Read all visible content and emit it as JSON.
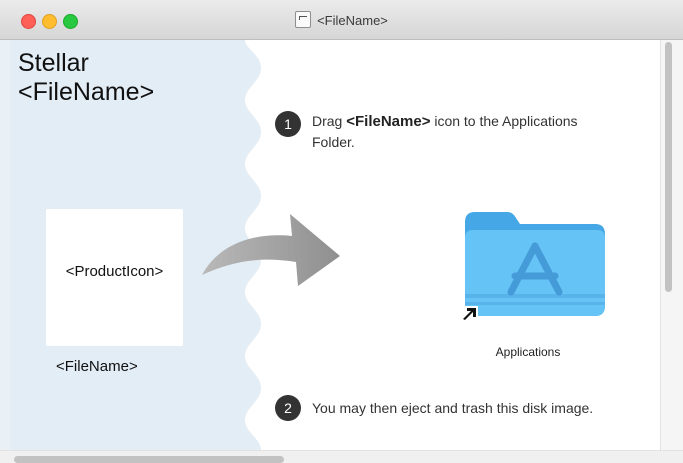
{
  "window": {
    "title": "<FileName>",
    "controls": [
      "close",
      "minimize",
      "zoom"
    ],
    "title_icon": "document-icon"
  },
  "left_panel": {
    "app_name": "Stellar",
    "file_name": "<FileName>",
    "product_icon_label": "<ProductIcon>",
    "product_file_label": "<FileName>"
  },
  "steps": [
    {
      "number": "1",
      "text_before": "Drag ",
      "highlight": "<FileName>",
      "text_after": " icon to the Applications Folder."
    },
    {
      "number": "2",
      "text": "You may then eject and trash this disk image."
    }
  ],
  "applications_folder": {
    "label": "Applications",
    "icon": "applications-folder-icon"
  },
  "colors": {
    "left_panel_bg": "#e3edf5",
    "folder_blue": "#5ab8f0",
    "arrow_gray": "#9a9a9a"
  }
}
